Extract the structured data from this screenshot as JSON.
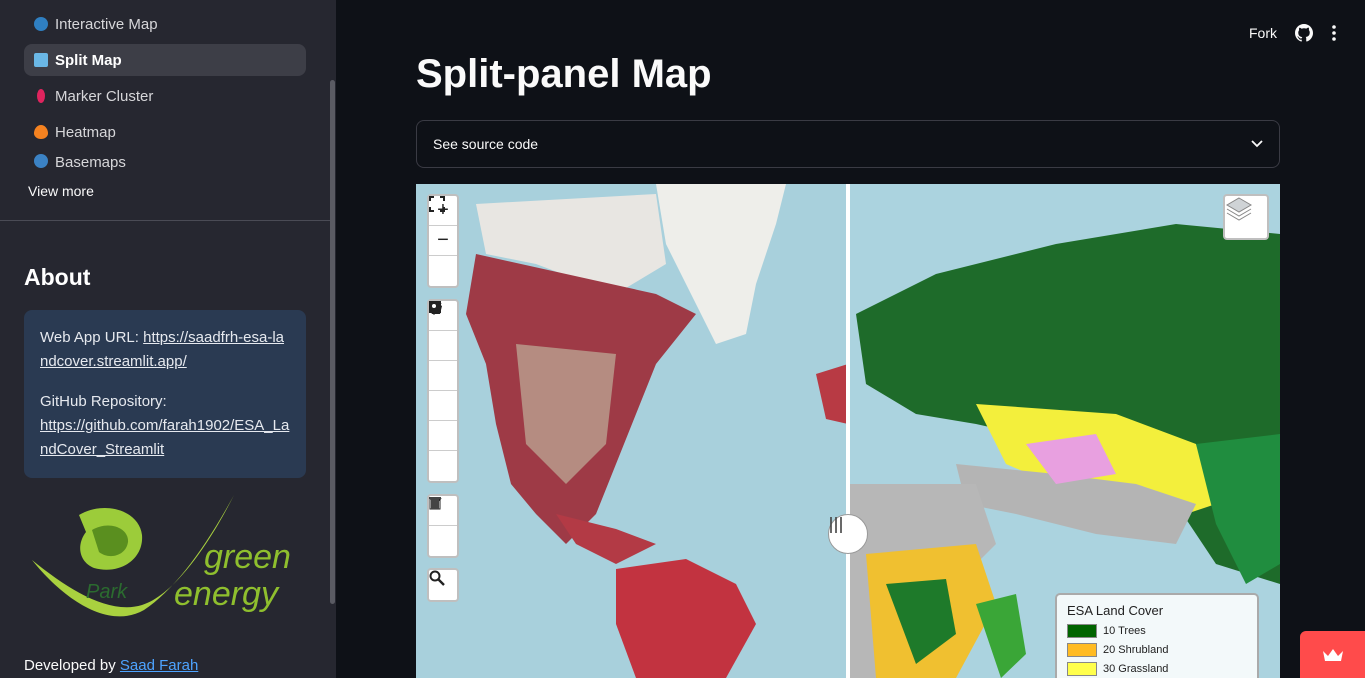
{
  "sidebar": {
    "nav_items": [
      {
        "label": "Interactive Map",
        "icon": "globe-icon",
        "color": "#3b82c4"
      },
      {
        "label": "Split Map",
        "icon": "split-map-icon",
        "color": "#6ab7e6",
        "active": true
      },
      {
        "label": "Marker Cluster",
        "icon": "pin-icon",
        "color": "#e0245e"
      },
      {
        "label": "Heatmap",
        "icon": "fire-icon",
        "color": "#f58220"
      },
      {
        "label": "Basemaps",
        "icon": "magnifier-icon",
        "color": "#3b82c4"
      }
    ],
    "view_more": "View more",
    "about_heading": "About",
    "info": {
      "webapp_label": "Web App URL: ",
      "webapp_url": "https://saadfrh-esa-landcover.streamlit.app/",
      "repo_label": "GitHub Repository:",
      "repo_url": "https://github.com/farah1902/ESA_LandCover_Streamlit"
    },
    "logo": {
      "park": "Park",
      "green": "green",
      "energy": "energy"
    },
    "developed_by": "Developed by ",
    "developer": "Saad Farah"
  },
  "header": {
    "fork_label": "Fork"
  },
  "main": {
    "title": "Split-panel Map",
    "expander_label": "See source code"
  },
  "map": {
    "legend_title": "ESA Land Cover",
    "legend_items": [
      {
        "label": "10 Trees",
        "color": "#006400"
      },
      {
        "label": "20 Shrubland",
        "color": "#ffbb22"
      },
      {
        "label": "30 Grassland",
        "color": "#ffff4c"
      }
    ]
  }
}
